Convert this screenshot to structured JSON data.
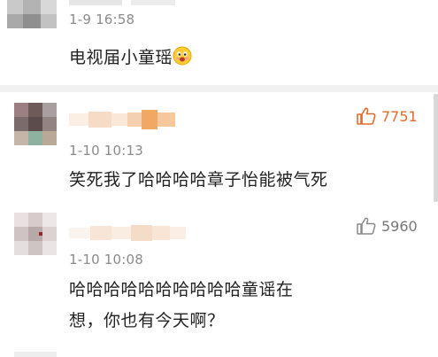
{
  "comments": [
    {
      "timestamp": "1-9 16:58",
      "text": "电视届小童瑶",
      "emoji": "drooling-face-emoji"
    },
    {
      "timestamp": "1-10 10:13",
      "text": "笑死我了哈哈哈哈章子怡能被气死",
      "likes": "7751",
      "liked": true,
      "like_color": "#e8692a"
    },
    {
      "timestamp": "1-10 10:08",
      "text_line1": "哈哈哈哈哈哈哈哈哈哈童谣在",
      "text_line2": "想，你也有今天啊？",
      "likes": "5960",
      "liked": false,
      "like_color": "#888888"
    }
  ],
  "icons": {
    "like": "thumbs-up-icon"
  }
}
